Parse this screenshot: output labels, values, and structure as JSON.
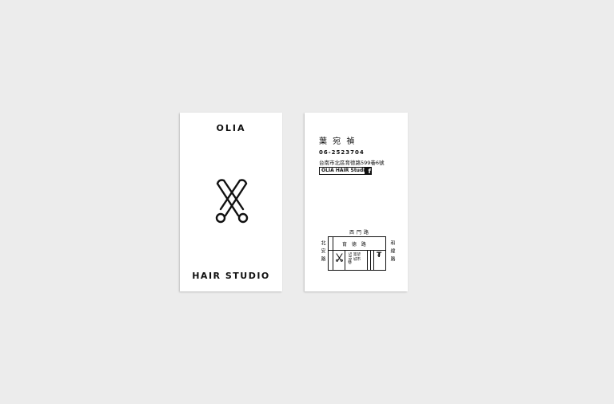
{
  "front": {
    "title": "OLIA",
    "subtitle": "HAIR  STUDIO",
    "logo_icon": "scissors-icon"
  },
  "back": {
    "name": "葉 宛 禎",
    "phone": "06-2523704",
    "address": "台南市北區育德路599巷6號",
    "facebook_label": "OLIA HAIR Studio",
    "facebook_icon": "facebook-icon",
    "map": {
      "top_road": "西門路",
      "inner_road": "育 德 路",
      "left_road": "北安路",
      "right_road": "和緯路",
      "lane": "599巷",
      "building": "築望城市"
    }
  }
}
